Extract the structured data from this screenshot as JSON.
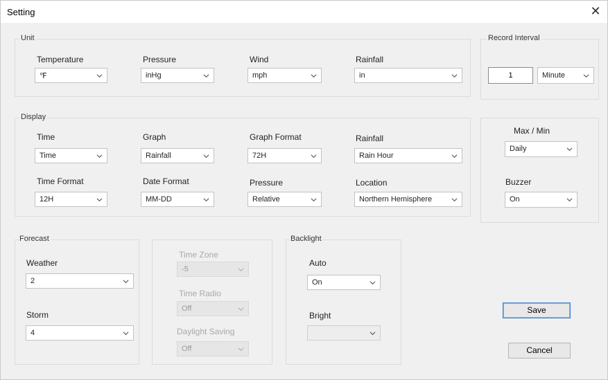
{
  "window": {
    "title": "Setting",
    "close_glyph": "✕"
  },
  "unit": {
    "legend": "Unit",
    "temperature": {
      "label": "Temperature",
      "value": "℉"
    },
    "pressure": {
      "label": "Pressure",
      "value": "inHg"
    },
    "wind": {
      "label": "Wind",
      "value": "mph"
    },
    "rainfall": {
      "label": "Rainfall",
      "value": "in"
    }
  },
  "record_interval": {
    "legend": "Record Interval",
    "value": "1",
    "unit": "Minute"
  },
  "display": {
    "legend": "Display",
    "time": {
      "label": "Time",
      "value": "Time"
    },
    "graph": {
      "label": "Graph",
      "value": "Rainfall"
    },
    "graph_format": {
      "label": "Graph Format",
      "value": "72H"
    },
    "rainfall": {
      "label": "Rainfall",
      "value": "Rain Hour"
    },
    "time_format": {
      "label": "Time Format",
      "value": "12H"
    },
    "date_format": {
      "label": "Date Format",
      "value": "MM-DD"
    },
    "pressure": {
      "label": "Pressure",
      "value": "Relative"
    },
    "location": {
      "label": "Location",
      "value": "Northern Hemisphere"
    }
  },
  "maxmin": {
    "label": "Max / Min",
    "value": "Daily"
  },
  "buzzer": {
    "label": "Buzzer",
    "value": "On"
  },
  "forecast": {
    "legend": "Forecast",
    "weather": {
      "label": "Weather",
      "value": "2"
    },
    "storm": {
      "label": "Storm",
      "value": "4"
    }
  },
  "time": {
    "time_zone": {
      "label": "Time Zone",
      "value": "-5"
    },
    "time_radio": {
      "label": "Time Radio",
      "value": "Off"
    },
    "daylight_saving": {
      "label": "Daylight Saving",
      "value": "Off"
    }
  },
  "backlight": {
    "legend": "Backlight",
    "auto": {
      "label": "Auto",
      "value": "On"
    },
    "bright": {
      "label": "Bright",
      "value": ""
    }
  },
  "buttons": {
    "save": "Save",
    "cancel": "Cancel"
  }
}
